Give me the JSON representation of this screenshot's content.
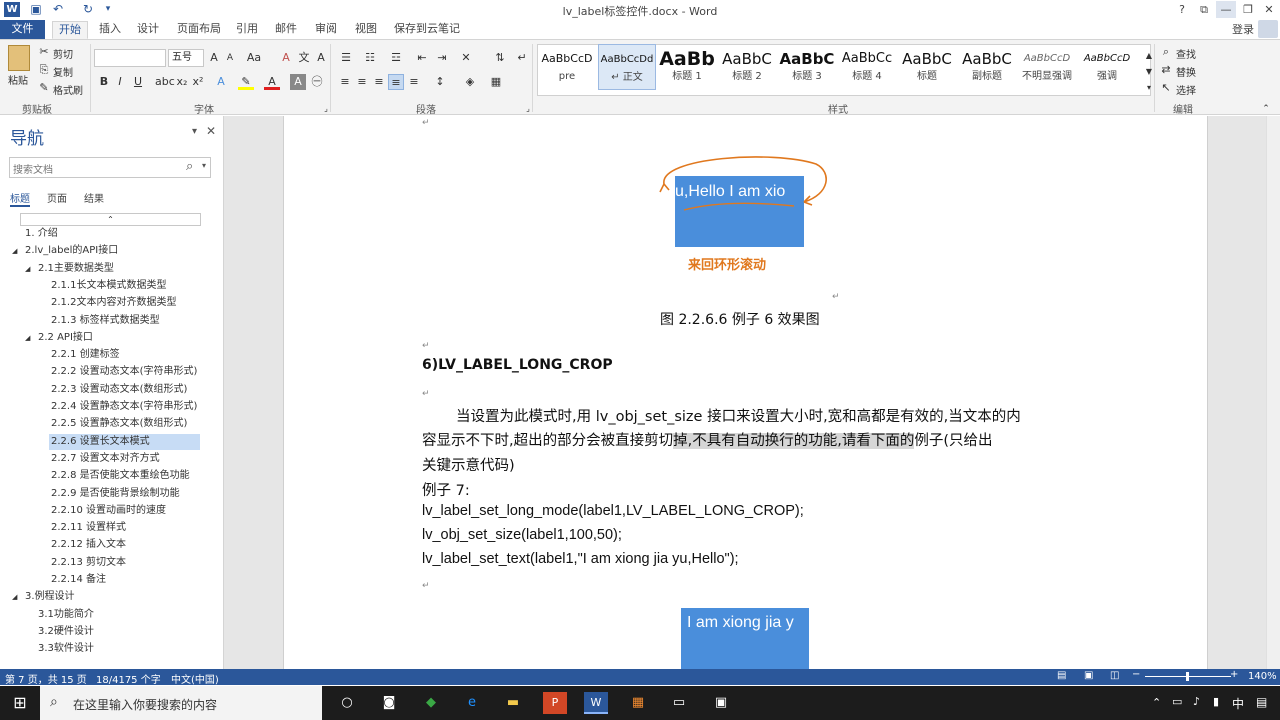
{
  "window": {
    "title": "lv_label标签控件.docx - Word",
    "help": "?",
    "login": "登录"
  },
  "tabs": [
    "文件",
    "开始",
    "插入",
    "设计",
    "页面布局",
    "引用",
    "邮件",
    "审阅",
    "视图",
    "保存到云笔记"
  ],
  "ribbon": {
    "clipboard": {
      "paste": "粘贴",
      "cut": "剪切",
      "copy": "复制",
      "format_painter": "格式刷",
      "label": "剪贴板"
    },
    "font": {
      "name": "",
      "size": "五号",
      "label": "字体"
    },
    "paragraph": {
      "label": "段落"
    },
    "styles": {
      "label": "样式",
      "items": [
        {
          "preview": "AaBbCcD",
          "name": "pre"
        },
        {
          "preview": "AaBbCcDd",
          "name": "↵ 正文"
        },
        {
          "preview": "AaBb",
          "name": "标题 1"
        },
        {
          "preview": "AaBbC",
          "name": "标题 2"
        },
        {
          "preview": "AaBbC",
          "name": "标题 3"
        },
        {
          "preview": "AaBbCc",
          "name": "标题 4"
        },
        {
          "preview": "AaBbC",
          "name": "标题"
        },
        {
          "preview": "AaBbC",
          "name": "副标题"
        },
        {
          "preview": "AaBbCcD",
          "name": "不明显强调"
        },
        {
          "preview": "AaBbCcD",
          "name": "强调"
        }
      ]
    },
    "editing": {
      "find": "查找",
      "replace": "替换",
      "select": "选择",
      "label": "编辑"
    }
  },
  "nav": {
    "title": "导航",
    "search_placeholder": "搜索文档",
    "tabs": [
      "标题",
      "页面",
      "结果"
    ],
    "items": [
      {
        "label": "1. 介绍",
        "level": 1
      },
      {
        "label": "2.lv_label的API接口",
        "level": 1
      },
      {
        "label": "2.1主要数据类型",
        "level": 2
      },
      {
        "label": "2.1.1长文本模式数据类型",
        "level": 3
      },
      {
        "label": "2.1.2文本内容对齐数据类型",
        "level": 3
      },
      {
        "label": "2.1.3 标签样式数据类型",
        "level": 3
      },
      {
        "label": "2.2 API接口",
        "level": 2
      },
      {
        "label": "2.2.1 创建标签",
        "level": 3
      },
      {
        "label": "2.2.2 设置动态文本(字符串形式)",
        "level": 3
      },
      {
        "label": "2.2.3 设置动态文本(数组形式)",
        "level": 3
      },
      {
        "label": "2.2.4 设置静态文本(字符串形式)",
        "level": 3
      },
      {
        "label": "2.2.5 设置静态文本(数组形式)",
        "level": 3
      },
      {
        "label": "2.2.6 设置长文本模式",
        "level": 3,
        "selected": true
      },
      {
        "label": "2.2.7 设置文本对齐方式",
        "level": 3
      },
      {
        "label": "2.2.8 是否使能文本重绘色功能",
        "level": 3
      },
      {
        "label": "2.2.9 是否使能背景绘制功能",
        "level": 3
      },
      {
        "label": "2.2.10 设置动画时的速度",
        "level": 3
      },
      {
        "label": "2.2.11 设置样式",
        "level": 3
      },
      {
        "label": "2.2.12 插入文本",
        "level": 3
      },
      {
        "label": "2.2.13 剪切文本",
        "level": 3
      },
      {
        "label": "2.2.14 备注",
        "level": 3
      },
      {
        "label": "3.例程设计",
        "level": 1
      },
      {
        "label": "3.1功能简介",
        "level": 2
      },
      {
        "label": "3.2硬件设计",
        "level": 2
      },
      {
        "label": "3.3软件设计",
        "level": 2
      }
    ]
  },
  "document": {
    "figure1_label_text": "u,Hello   I am xio",
    "figure1_caption_img": "来回环形滚动",
    "figure1_caption": "图 2.2.6.6  例子 6 效果图",
    "heading": "6)LV_LABEL_LONG_CROP",
    "para1_line1": "当设置为此模式时,用 lv_obj_set_size 接口来设置大小时,宽和高都是有效的,当文本的内",
    "para1_line2_a": "容显示不下时,超出的部分会被直接剪切",
    "para1_line2_b": "掉,不具有自动换行的功能,请看下面的",
    "para1_line2_c": "例子(只给出",
    "para1_line3": "关键示意代码)",
    "example_label": "例子 7:",
    "code1": "lv_label_set_long_mode(label1,LV_LABEL_LONG_CROP);",
    "code2": "lv_obj_set_size(label1,100,50);",
    "code3": "lv_label_set_text(label1,\"I am xiong jia yu,Hello\");",
    "figure2_label_text": "I am xiong jia y"
  },
  "status": {
    "page": "第 7 页，共 15 页",
    "words": "18/4175 个字",
    "lang": "中文(中国)",
    "zoom": "140%"
  },
  "taskbar": {
    "search_placeholder": "在这里输入你要搜索的内容",
    "ime": "中"
  },
  "colors": {
    "accent": "#2b579a",
    "figure_bg": "#4a8edb",
    "annotation": "#e0781e"
  }
}
